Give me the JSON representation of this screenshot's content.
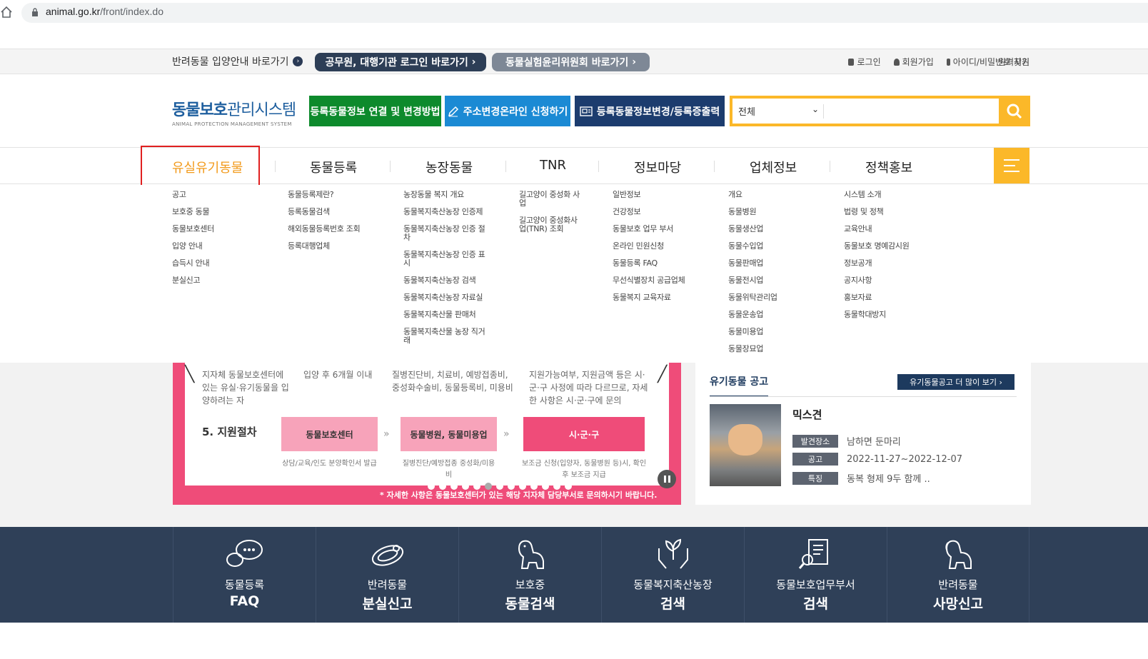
{
  "browser": {
    "url_host": "animal.go.kr",
    "url_path": "/front/index.do"
  },
  "topbar": {
    "adopt_link": "반려동물 입양안내 바로가기",
    "official_login": "공무원, 대행기관 로그인 바로가기",
    "ethics_committee": "동물실험윤리위원회 바로가기",
    "login": "로그인",
    "signup": "회원가입",
    "find_account": "아이디/비밀번호 찾기",
    "remote_support": "원격지원"
  },
  "header": {
    "logo_bold": "동물보호",
    "logo_rest": "관리시스템",
    "logo_en": "ANIMAL PROTECTION MANAGEMENT SYSTEM",
    "btn_registration_change": "등록동물정보 연결 및 변경방법",
    "btn_address_change": "주소변경온라인 신청하기",
    "btn_certificate": "등록동물정보변경/등록증출력",
    "search_scope": "전체",
    "search_placeholder": ""
  },
  "nav": {
    "items": [
      "유실유기동물",
      "동물등록",
      "농장동물",
      "TNR",
      "정보마당",
      "업체정보",
      "정책홍보"
    ],
    "active_index": 0
  },
  "dropdown": {
    "col1": [
      "공고",
      "보호중 동물",
      "동물보호센터",
      "입양 안내",
      "습득시 안내",
      "분실신고"
    ],
    "col2": [
      "동물등록제란?",
      "등록동물검색",
      "해외동물등록번호 조회",
      "등록대행업체"
    ],
    "col3": [
      "농장동물 복지 개요",
      "동물복지축산농장 인증제",
      "동물복지축산농장 인증 절차",
      "동물복지축산농장 인증 표시",
      "동물복지축산농장 검색",
      "동물복지축산농장 자료실",
      "동물복지축산물 판매처",
      "동물복지축산물 농장 직거래"
    ],
    "col4": [
      "길고양이 중성화 사업",
      "길고양이 중성화사업(TNR) 조회"
    ],
    "col5": [
      "일반정보",
      "건강정보",
      "동물보호 업무 부서",
      "온라인 민원신청",
      "동물등록 FAQ",
      "무선식별장치 공급업체",
      "동물복지 교육자료"
    ],
    "col6": [
      "개요",
      "동물병원",
      "동물생산업",
      "동물수입업",
      "동물판매업",
      "동물전시업",
      "동물위탁관리업",
      "동물운송업",
      "동물미용업",
      "동물장묘업"
    ],
    "col7": [
      "시스템 소개",
      "법령 및 정책",
      "교육안내",
      "동물보호 명예감시원",
      "정보공개",
      "공지사항",
      "홍보자료",
      "동물학대방지"
    ]
  },
  "slider": {
    "q1": "지자체 동물보호센터에 있는 유실·유기동물을 입양하려는 자",
    "q2": "입양 후 6개월 이내",
    "q3": "질병진단비, 치료비, 예방접종비, 중성화수술비, 동물등록비, 미용비",
    "q4": "지원가능여부, 지원금액 등은 시·군·구 사정에 따라 다르므로, 자세한 사항은 시·군·구에 문의",
    "step_title": "5. 지원절차",
    "box1": "동물보호센터",
    "box2": "동물병원, 동물미용업",
    "box3": "시·군·구",
    "note1": "상담/교육/인도 분양확인서 발급",
    "note2": "질병진단/예방접종 중성화/미용비",
    "note3": "보조금 신청(입양자, 동물병원 등)시, 확인 후 보조금 지급",
    "footer": "* 자세한 사항은 동물보호센터가 있는 해당  지자체 담당부서로 문의하시기 바랍니다."
  },
  "lost_notice": {
    "title": "유기동물 공고",
    "more": "유기동물공고 더 많이 보기",
    "animal_name": "믹스견",
    "found_label": "발견장소",
    "found_value": "남하면 둔마리",
    "notice_label": "공고",
    "notice_value": "2022-11-27~2022-12-07",
    "feature_label": "특징",
    "feature_value": "동복 형제 9두 함께 .."
  },
  "quick_links": [
    {
      "line1": "동물등록",
      "line2": "FAQ",
      "icon": "chat-bubbles-icon"
    },
    {
      "line1": "반려동물",
      "line2": "분실신고",
      "icon": "collar-icon"
    },
    {
      "line1": "보호중",
      "line2": "동물검색",
      "icon": "dog-icon"
    },
    {
      "line1": "동물복지축산농장",
      "line2": "검색",
      "icon": "hands-plant-icon"
    },
    {
      "line1": "동물보호업무부서",
      "line2": "검색",
      "icon": "document-search-icon"
    },
    {
      "line1": "반려동물",
      "line2": "사망신고",
      "icon": "dog-outline-icon"
    }
  ]
}
